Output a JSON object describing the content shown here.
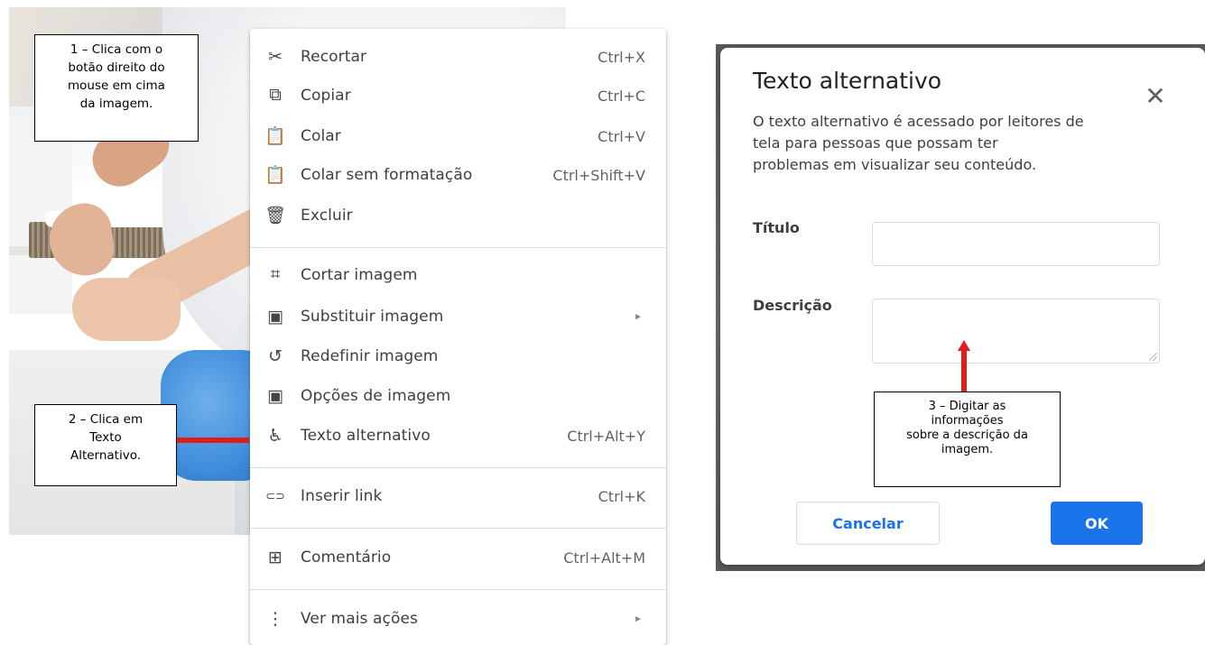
{
  "callouts": {
    "step1": [
      "1 – Clica com o",
      "botão direito do",
      "mouse em cima",
      "da imagem."
    ],
    "step2": [
      "2 – Clica em",
      "Texto",
      "Alternativo."
    ],
    "step3": [
      "3 – Digitar as",
      "informações",
      "sobre a  descrição da",
      "imagem."
    ]
  },
  "context_menu": {
    "items": [
      {
        "icon": "scissors-icon",
        "glyph": "✂",
        "label": "Recortar",
        "shortcut": "Ctrl+X"
      },
      {
        "icon": "copy-icon",
        "glyph": "⧉",
        "label": "Copiar",
        "shortcut": "Ctrl+C"
      },
      {
        "icon": "paste-icon",
        "glyph": "📋",
        "label": "Colar",
        "shortcut": "Ctrl+V"
      },
      {
        "icon": "paste-plain-icon",
        "glyph": "📋",
        "label": "Colar sem formatação",
        "shortcut": "Ctrl+Shift+V"
      },
      {
        "icon": "trash-icon",
        "glyph": "🗑",
        "label": "Excluir",
        "shortcut": ""
      },
      {
        "icon": "crop-icon",
        "glyph": "⌗",
        "label": "Cortar imagem",
        "shortcut": ""
      },
      {
        "icon": "image-icon",
        "glyph": "▣",
        "label": "Substituir imagem",
        "shortcut": ""
      },
      {
        "icon": "reset-image-icon",
        "glyph": "↺",
        "label": "Redefinir imagem",
        "shortcut": ""
      },
      {
        "icon": "image-options-icon",
        "glyph": "▣",
        "label": "Opções de imagem",
        "shortcut": ""
      },
      {
        "icon": "accessibility-icon",
        "glyph": "♿",
        "label": "Texto alternativo",
        "shortcut": "Ctrl+Alt+Y"
      },
      {
        "icon": "link-icon",
        "glyph": "⊂⊃",
        "label": "Inserir link",
        "shortcut": "Ctrl+K"
      },
      {
        "icon": "comment-add-icon",
        "glyph": "⊞",
        "label": "Comentário",
        "shortcut": "Ctrl+Alt+M"
      },
      {
        "icon": "more-vert-icon",
        "glyph": "⋮",
        "label": "Ver mais ações",
        "shortcut": ""
      }
    ],
    "submenu_arrow": "►"
  },
  "dialog": {
    "title": "Texto alternativo",
    "close_glyph": "✕",
    "description": "O texto alternativo é acessado por leitores de\ntela para pessoas que possam ter\nproblemas em visualizar seu conteúdo.",
    "title_label": "Título",
    "title_value": "",
    "description_label": "Descrição",
    "description_value": "",
    "cancel_label": "Cancelar",
    "ok_label": "OK"
  },
  "colors": {
    "accent": "#1a73e8",
    "annotation_red": "#e21b1b"
  }
}
